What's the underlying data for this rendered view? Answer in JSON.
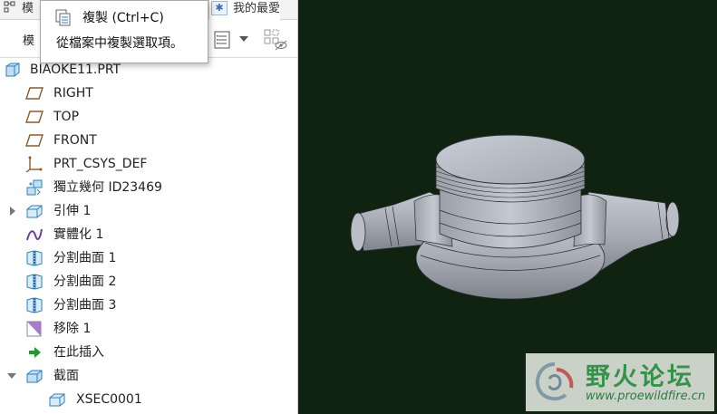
{
  "tabs": {
    "model_tree": "模",
    "favorites": "我的最愛"
  },
  "toolbar": {
    "label": "模"
  },
  "tooltip": {
    "title": "複製 (Ctrl+C)",
    "description": "從檔案中複製選取項。"
  },
  "tree": {
    "items": [
      {
        "label": "BIAOKE11.PRT",
        "icon": "part-icon"
      },
      {
        "label": "RIGHT",
        "icon": "datum-plane-icon"
      },
      {
        "label": "TOP",
        "icon": "datum-plane-icon"
      },
      {
        "label": "FRONT",
        "icon": "datum-plane-icon"
      },
      {
        "label": "PRT_CSYS_DEF",
        "icon": "csys-icon"
      },
      {
        "label": "獨立幾何 ID23469",
        "icon": "independent-geometry-icon"
      },
      {
        "label": "引伸 1",
        "icon": "extrude-icon"
      },
      {
        "label": "實體化 1",
        "icon": "solidify-icon"
      },
      {
        "label": "分割曲面 1",
        "icon": "split-surface-icon"
      },
      {
        "label": "分割曲面 2",
        "icon": "split-surface-icon"
      },
      {
        "label": "分割曲面 3",
        "icon": "split-surface-icon"
      },
      {
        "label": "移除 1",
        "icon": "remove-icon"
      },
      {
        "label": "在此插入",
        "icon": "insert-here-icon"
      },
      {
        "label": "截面",
        "icon": "section-folder-icon"
      },
      {
        "label": "XSEC0001",
        "icon": "xsec-icon"
      }
    ]
  },
  "watermark": {
    "title": "野火论坛",
    "url": "www.proewildfire.cn"
  },
  "colors": {
    "viewport_bg": "#0f2310",
    "model_gray": "#a9aeb7",
    "watermark_green": "#34924a"
  }
}
